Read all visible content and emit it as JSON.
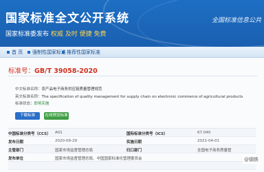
{
  "header": {
    "site_title": "国家标准全文公开系统",
    "slogan_part1": "国家标准委发布",
    "slogan_part2": "权威 及时 便捷 免费",
    "brand_right": "全国标准信息公共"
  },
  "nav": {
    "home": "首 页",
    "mandatory": "强制性国家标准",
    "recommended": "推荐性国家标准"
  },
  "standard": {
    "number_label": "标准号：",
    "number": "GB/T 39058-2020",
    "cn_title_label": "中文标准名称：",
    "cn_title": "农产品电子商务供应链质量管理规范",
    "en_title_label": "英文标准名称：",
    "en_title": "The specification of quality management for supply chain on electronic commerce of agricultural products",
    "status_label": "标准状态：",
    "status": "即将实施"
  },
  "buttons": {
    "download": "下载标准",
    "preview": "在线预览标准"
  },
  "table": {
    "rows": [
      {
        "k1": "中国标准分类号（CCS）",
        "v1": "A01",
        "k2": "国际标准分类号（ICS）",
        "v2": "67.040"
      },
      {
        "k1": "发布日期",
        "v1": "2020-09-29",
        "k2": "实施日期",
        "v2": "2021-04-01"
      },
      {
        "k1": "主管部门",
        "v1": "国家市场监督管理总局",
        "k2": "归口部门",
        "v2": "全国电子商务质量管"
      },
      {
        "k1": "发布单位",
        "v1": "国家市场监督管理总局、中国国家标准化管理委员会",
        "k2": "",
        "v2": ""
      },
      {
        "k1": "",
        "v1": "",
        "k2": "",
        "v2": ""
      }
    ]
  },
  "watermark": "@钢铁"
}
